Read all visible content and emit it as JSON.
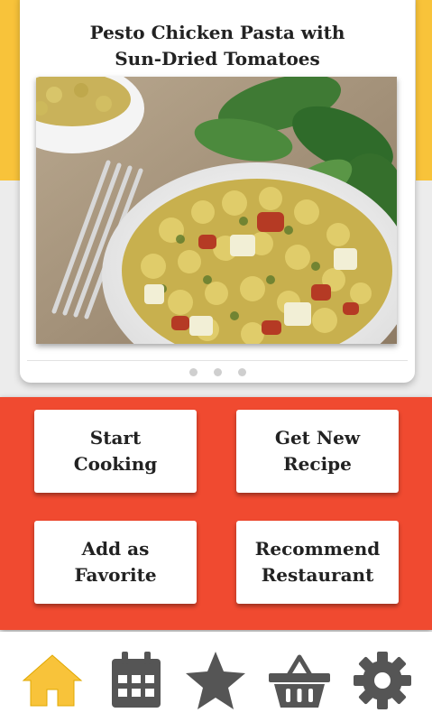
{
  "recipe": {
    "title_line1": "Pesto Chicken Pasta with",
    "title_line2": "Sun-Dried Tomatoes"
  },
  "carousel": {
    "page_count": 3
  },
  "actions": {
    "start_cooking": [
      "Start",
      "Cooking"
    ],
    "new_recipe": [
      "Get New",
      "Recipe"
    ],
    "favorite": [
      "Add as",
      "Favorite"
    ],
    "restaurant": [
      "Recommend",
      "Restaurant"
    ]
  },
  "colors": {
    "accent_red": "#f04a30",
    "accent_yellow": "#f8c33a",
    "nav_active": "#f8c33a",
    "nav_inactive": "#555555"
  },
  "nav": {
    "items": [
      "home-icon",
      "calendar-icon",
      "star-icon",
      "basket-icon",
      "gear-icon"
    ],
    "active": "home-icon"
  }
}
